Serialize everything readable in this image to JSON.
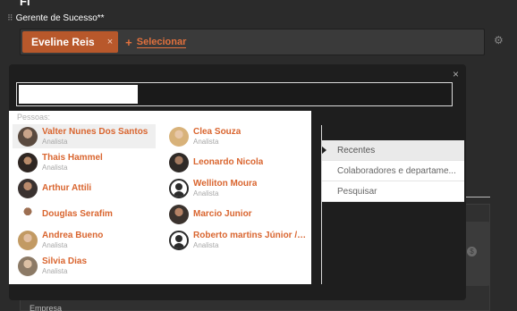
{
  "page": {
    "title_fragment": "Fl"
  },
  "field": {
    "label": "Gerente de Sucesso**",
    "chip_label": "Eveline Reis",
    "chip_remove": "×",
    "select_plus": "+",
    "select_label": "Selecionar"
  },
  "background": {
    "empresa_label": "Empresa",
    "coin_glyph": "$"
  },
  "modal": {
    "close": "×",
    "search_value": "",
    "people_header": "Pessoas:",
    "people": [
      {
        "name": "Valter Nunes Dos Santos",
        "role": "Analista",
        "avatar": "photo"
      },
      {
        "name": "Clea Souza",
        "role": "Analista",
        "avatar": "photo"
      },
      {
        "name": "Thais Hammel",
        "role": "Analista",
        "avatar": "photo"
      },
      {
        "name": "Leonardo Nicola",
        "role": "",
        "avatar": "photo"
      },
      {
        "name": "Arthur Attili",
        "role": "",
        "avatar": "photo"
      },
      {
        "name": "Welliton Moura",
        "role": "Analista",
        "avatar": "placeholder"
      },
      {
        "name": "Douglas Serafim",
        "role": "",
        "avatar": "photo"
      },
      {
        "name": "Marcio Junior",
        "role": "",
        "avatar": "photo"
      },
      {
        "name": "Andrea Bueno",
        "role": "Analista",
        "avatar": "photo"
      },
      {
        "name": "Roberto martins Júnior / ...",
        "role": "Analista",
        "avatar": "placeholder"
      },
      {
        "name": "Silvia Dias",
        "role": "Analista",
        "avatar": "photo"
      }
    ],
    "menu": [
      {
        "label": "Recentes",
        "active": true
      },
      {
        "label": "Colaboradores e departame...",
        "active": false
      },
      {
        "label": "Pesquisar",
        "active": false
      }
    ]
  },
  "colors": {
    "accent": "#d9652f",
    "chip": "#b8582b"
  },
  "icons": {
    "drag": "drag-handle-icon",
    "settings": "gear-icon",
    "close": "close-icon",
    "avatar_placeholder": "user-icon"
  }
}
